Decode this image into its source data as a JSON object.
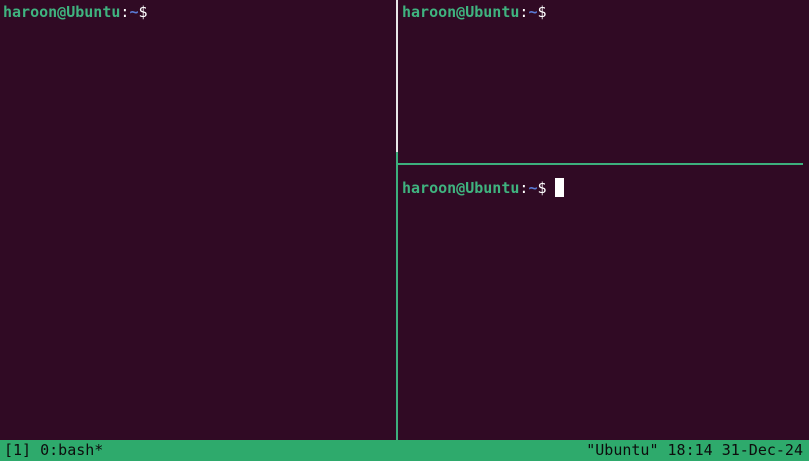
{
  "prompt": {
    "user_host": "haroon@Ubuntu",
    "colon": ":",
    "path": "~",
    "dollar": "$"
  },
  "status_bar": {
    "session": "[1]",
    "window": "0:bash*",
    "host": "\"Ubuntu\"",
    "time": "18:14",
    "date": "31-Dec-24"
  },
  "colors": {
    "background": "#300a24",
    "prompt_green": "#3fb37f",
    "prompt_path_blue": "#5a7bd6",
    "status_bar_bg": "#2eaa6c",
    "active_border": "#3daf7d"
  }
}
